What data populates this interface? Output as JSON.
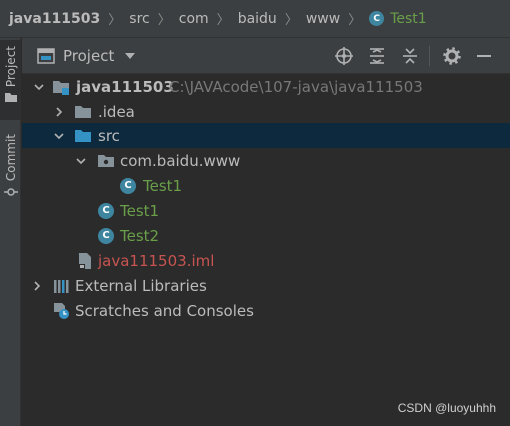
{
  "breadcrumb": {
    "project": "java111503",
    "items": [
      "src",
      "com",
      "baidu",
      "www"
    ],
    "current_file": "Test1",
    "current_file_icon": "class-icon"
  },
  "sidebar_tabs": {
    "project": "Project",
    "commit": "Commit"
  },
  "panel": {
    "title": "Project",
    "actions": [
      "locate-icon",
      "expand-all-icon",
      "collapse-all-icon",
      "settings-icon",
      "hide-icon"
    ]
  },
  "tree": {
    "root_name": "java111503",
    "root_path": "C:\\JAVAcode\\107-java\\java111503",
    "idea": ".idea",
    "src": "src",
    "package": "com.baidu.www",
    "pkg_class": "Test1",
    "class1": "Test1",
    "class2": "Test2",
    "iml": "java111503.iml",
    "external_libraries": "External Libraries",
    "scratches": "Scratches and Consoles"
  },
  "colors": {
    "background": "#2b2b2b",
    "selection": "#0d293e",
    "class_text": "#6a9f4a",
    "iml_text": "#c75450",
    "class_icon": "#3e86a0"
  },
  "watermark": "CSDN @luoyuhhh"
}
